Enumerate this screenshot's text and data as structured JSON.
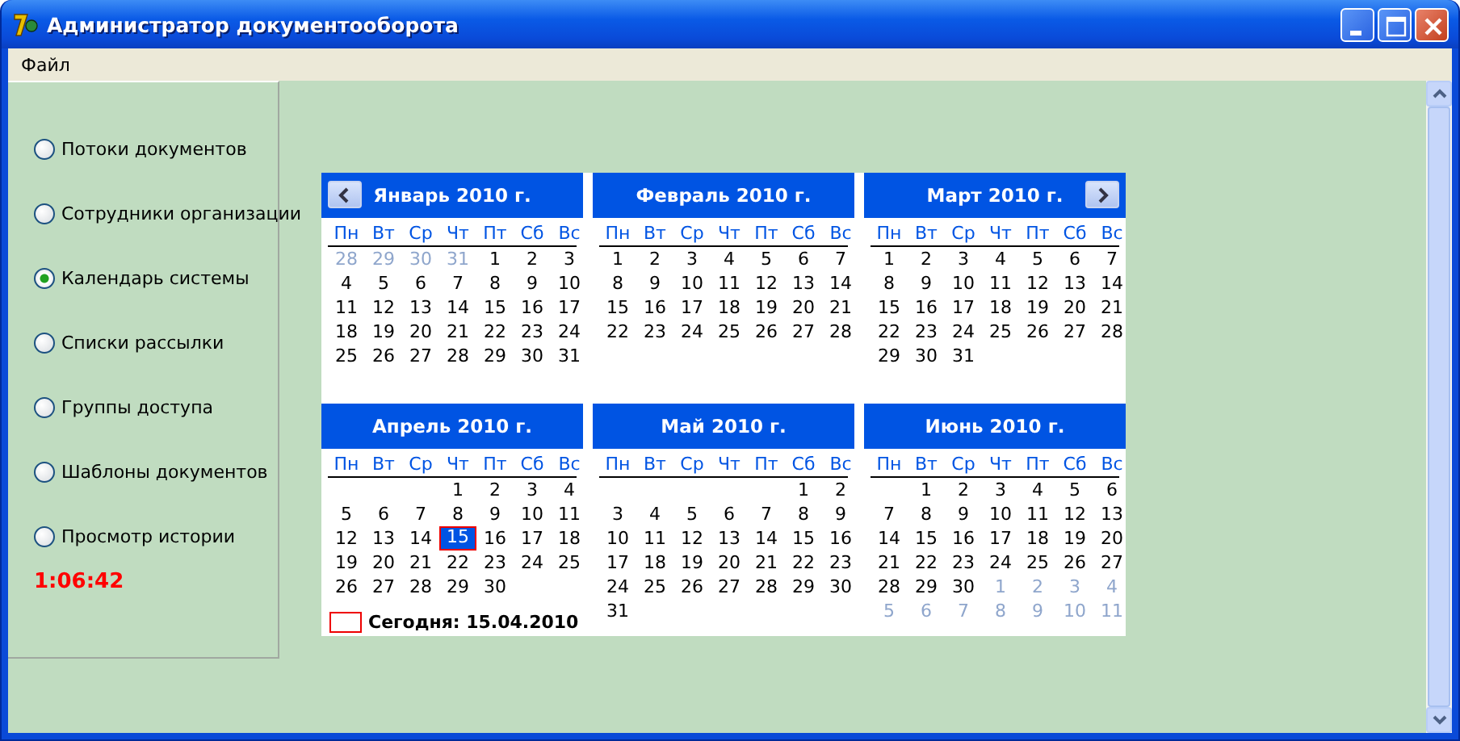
{
  "window": {
    "title": "Администратор документооборота"
  },
  "menu": [
    "Файл"
  ],
  "sidebar": {
    "options": [
      {
        "label": "Потоки документов",
        "selected": false
      },
      {
        "label": "Сотрудники организации",
        "selected": false
      },
      {
        "label": "Календарь системы",
        "selected": true
      },
      {
        "label": "Списки рассылки",
        "selected": false
      },
      {
        "label": "Группы доступа",
        "selected": false
      },
      {
        "label": "Шаблоны документов",
        "selected": false
      },
      {
        "label": "Просмотр истории",
        "selected": false
      }
    ],
    "clock": "1:06:42"
  },
  "calendar": {
    "months": [
      {
        "title": "Январь 2010 г.",
        "prev_button": true,
        "weekdays": [
          "Пн",
          "Вт",
          "Ср",
          "Чт",
          "Пт",
          "Сб",
          "Вс"
        ],
        "weeks": [
          [
            {
              "day": "28",
              "kind": "other"
            },
            {
              "day": "29",
              "kind": "other"
            },
            {
              "day": "30",
              "kind": "other"
            },
            {
              "day": "31",
              "kind": "other"
            },
            {
              "day": "1",
              "kind": "day"
            },
            {
              "day": "2",
              "kind": "day"
            },
            {
              "day": "3",
              "kind": "day"
            }
          ],
          [
            {
              "day": "4",
              "kind": "day"
            },
            {
              "day": "5",
              "kind": "day"
            },
            {
              "day": "6",
              "kind": "day"
            },
            {
              "day": "7",
              "kind": "day"
            },
            {
              "day": "8",
              "kind": "day"
            },
            {
              "day": "9",
              "kind": "day"
            },
            {
              "day": "10",
              "kind": "day"
            }
          ],
          [
            {
              "day": "11",
              "kind": "day"
            },
            {
              "day": "12",
              "kind": "day"
            },
            {
              "day": "13",
              "kind": "day"
            },
            {
              "day": "14",
              "kind": "day"
            },
            {
              "day": "15",
              "kind": "day"
            },
            {
              "day": "16",
              "kind": "day"
            },
            {
              "day": "17",
              "kind": "day"
            }
          ],
          [
            {
              "day": "18",
              "kind": "day"
            },
            {
              "day": "19",
              "kind": "day"
            },
            {
              "day": "20",
              "kind": "day"
            },
            {
              "day": "21",
              "kind": "day"
            },
            {
              "day": "22",
              "kind": "day"
            },
            {
              "day": "23",
              "kind": "day"
            },
            {
              "day": "24",
              "kind": "day"
            }
          ],
          [
            {
              "day": "25",
              "kind": "day"
            },
            {
              "day": "26",
              "kind": "day"
            },
            {
              "day": "27",
              "kind": "day"
            },
            {
              "day": "28",
              "kind": "day"
            },
            {
              "day": "29",
              "kind": "day"
            },
            {
              "day": "30",
              "kind": "day"
            },
            {
              "day": "31",
              "kind": "day"
            }
          ]
        ]
      },
      {
        "title": "Февраль 2010 г.",
        "weekdays": [
          "Пн",
          "Вт",
          "Ср",
          "Чт",
          "Пт",
          "Сб",
          "Вс"
        ],
        "weeks": [
          [
            {
              "day": "1",
              "kind": "day"
            },
            {
              "day": "2",
              "kind": "day"
            },
            {
              "day": "3",
              "kind": "day"
            },
            {
              "day": "4",
              "kind": "day"
            },
            {
              "day": "5",
              "kind": "day"
            },
            {
              "day": "6",
              "kind": "day"
            },
            {
              "day": "7",
              "kind": "day"
            }
          ],
          [
            {
              "day": "8",
              "kind": "day"
            },
            {
              "day": "9",
              "kind": "day"
            },
            {
              "day": "10",
              "kind": "day"
            },
            {
              "day": "11",
              "kind": "day"
            },
            {
              "day": "12",
              "kind": "day"
            },
            {
              "day": "13",
              "kind": "day"
            },
            {
              "day": "14",
              "kind": "day"
            }
          ],
          [
            {
              "day": "15",
              "kind": "day"
            },
            {
              "day": "16",
              "kind": "day"
            },
            {
              "day": "17",
              "kind": "day"
            },
            {
              "day": "18",
              "kind": "day"
            },
            {
              "day": "19",
              "kind": "day"
            },
            {
              "day": "20",
              "kind": "day"
            },
            {
              "day": "21",
              "kind": "day"
            }
          ],
          [
            {
              "day": "22",
              "kind": "day"
            },
            {
              "day": "23",
              "kind": "day"
            },
            {
              "day": "24",
              "kind": "day"
            },
            {
              "day": "25",
              "kind": "day"
            },
            {
              "day": "26",
              "kind": "day"
            },
            {
              "day": "27",
              "kind": "day"
            },
            {
              "day": "28",
              "kind": "day"
            }
          ]
        ]
      },
      {
        "title": "Март 2010 г.",
        "next_button": true,
        "weekdays": [
          "Пн",
          "Вт",
          "Ср",
          "Чт",
          "Пт",
          "Сб",
          "Вс"
        ],
        "weeks": [
          [
            {
              "day": "1",
              "kind": "day"
            },
            {
              "day": "2",
              "kind": "day"
            },
            {
              "day": "3",
              "kind": "day"
            },
            {
              "day": "4",
              "kind": "day"
            },
            {
              "day": "5",
              "kind": "day"
            },
            {
              "day": "6",
              "kind": "day"
            },
            {
              "day": "7",
              "kind": "day"
            }
          ],
          [
            {
              "day": "8",
              "kind": "day"
            },
            {
              "day": "9",
              "kind": "day"
            },
            {
              "day": "10",
              "kind": "day"
            },
            {
              "day": "11",
              "kind": "day"
            },
            {
              "day": "12",
              "kind": "day"
            },
            {
              "day": "13",
              "kind": "day"
            },
            {
              "day": "14",
              "kind": "day"
            }
          ],
          [
            {
              "day": "15",
              "kind": "day"
            },
            {
              "day": "16",
              "kind": "day"
            },
            {
              "day": "17",
              "kind": "day"
            },
            {
              "day": "18",
              "kind": "day"
            },
            {
              "day": "19",
              "kind": "day"
            },
            {
              "day": "20",
              "kind": "day"
            },
            {
              "day": "21",
              "kind": "day"
            }
          ],
          [
            {
              "day": "22",
              "kind": "day"
            },
            {
              "day": "23",
              "kind": "day"
            },
            {
              "day": "24",
              "kind": "day"
            },
            {
              "day": "25",
              "kind": "day"
            },
            {
              "day": "26",
              "kind": "day"
            },
            {
              "day": "27",
              "kind": "day"
            },
            {
              "day": "28",
              "kind": "day"
            }
          ],
          [
            {
              "day": "29",
              "kind": "day"
            },
            {
              "day": "30",
              "kind": "day"
            },
            {
              "day": "31",
              "kind": "day"
            }
          ]
        ]
      },
      {
        "title": "Апрель 2010 г.",
        "weekdays": [
          "Пн",
          "Вт",
          "Ср",
          "Чт",
          "Пт",
          "Сб",
          "Вс"
        ],
        "weeks": [
          [
            {
              "kind": "blank"
            },
            {
              "kind": "blank"
            },
            {
              "kind": "blank"
            },
            {
              "day": "1",
              "kind": "day"
            },
            {
              "day": "2",
              "kind": "day"
            },
            {
              "day": "3",
              "kind": "day"
            },
            {
              "day": "4",
              "kind": "day"
            }
          ],
          [
            {
              "day": "5",
              "kind": "day"
            },
            {
              "day": "6",
              "kind": "day"
            },
            {
              "day": "7",
              "kind": "day"
            },
            {
              "day": "8",
              "kind": "day"
            },
            {
              "day": "9",
              "kind": "day"
            },
            {
              "day": "10",
              "kind": "day"
            },
            {
              "day": "11",
              "kind": "day"
            }
          ],
          [
            {
              "day": "12",
              "kind": "day"
            },
            {
              "day": "13",
              "kind": "day"
            },
            {
              "day": "14",
              "kind": "day"
            },
            {
              "day": "15",
              "kind": "today"
            },
            {
              "day": "16",
              "kind": "day"
            },
            {
              "day": "17",
              "kind": "day"
            },
            {
              "day": "18",
              "kind": "day"
            }
          ],
          [
            {
              "day": "19",
              "kind": "day"
            },
            {
              "day": "20",
              "kind": "day"
            },
            {
              "day": "21",
              "kind": "day"
            },
            {
              "day": "22",
              "kind": "day"
            },
            {
              "day": "23",
              "kind": "day"
            },
            {
              "day": "24",
              "kind": "day"
            },
            {
              "day": "25",
              "kind": "day"
            }
          ],
          [
            {
              "day": "26",
              "kind": "day"
            },
            {
              "day": "27",
              "kind": "day"
            },
            {
              "day": "28",
              "kind": "day"
            },
            {
              "day": "29",
              "kind": "day"
            },
            {
              "day": "30",
              "kind": "day"
            }
          ]
        ]
      },
      {
        "title": "Май 2010 г.",
        "weekdays": [
          "Пн",
          "Вт",
          "Ср",
          "Чт",
          "Пт",
          "Сб",
          "Вс"
        ],
        "weeks": [
          [
            {
              "kind": "blank"
            },
            {
              "kind": "blank"
            },
            {
              "kind": "blank"
            },
            {
              "kind": "blank"
            },
            {
              "kind": "blank"
            },
            {
              "day": "1",
              "kind": "day"
            },
            {
              "day": "2",
              "kind": "day"
            }
          ],
          [
            {
              "day": "3",
              "kind": "day"
            },
            {
              "day": "4",
              "kind": "day"
            },
            {
              "day": "5",
              "kind": "day"
            },
            {
              "day": "6",
              "kind": "day"
            },
            {
              "day": "7",
              "kind": "day"
            },
            {
              "day": "8",
              "kind": "day"
            },
            {
              "day": "9",
              "kind": "day"
            }
          ],
          [
            {
              "day": "10",
              "kind": "day"
            },
            {
              "day": "11",
              "kind": "day"
            },
            {
              "day": "12",
              "kind": "day"
            },
            {
              "day": "13",
              "kind": "day"
            },
            {
              "day": "14",
              "kind": "day"
            },
            {
              "day": "15",
              "kind": "day"
            },
            {
              "day": "16",
              "kind": "day"
            }
          ],
          [
            {
              "day": "17",
              "kind": "day"
            },
            {
              "day": "18",
              "kind": "day"
            },
            {
              "day": "19",
              "kind": "day"
            },
            {
              "day": "20",
              "kind": "day"
            },
            {
              "day": "21",
              "kind": "day"
            },
            {
              "day": "22",
              "kind": "day"
            },
            {
              "day": "23",
              "kind": "day"
            }
          ],
          [
            {
              "day": "24",
              "kind": "day"
            },
            {
              "day": "25",
              "kind": "day"
            },
            {
              "day": "26",
              "kind": "day"
            },
            {
              "day": "27",
              "kind": "day"
            },
            {
              "day": "28",
              "kind": "day"
            },
            {
              "day": "29",
              "kind": "day"
            },
            {
              "day": "30",
              "kind": "day"
            }
          ],
          [
            {
              "day": "31",
              "kind": "day"
            }
          ]
        ]
      },
      {
        "title": "Июнь 2010 г.",
        "weekdays": [
          "Пн",
          "Вт",
          "Ср",
          "Чт",
          "Пт",
          "Сб",
          "Вс"
        ],
        "weeks": [
          [
            {
              "kind": "blank"
            },
            {
              "day": "1",
              "kind": "day"
            },
            {
              "day": "2",
              "kind": "day"
            },
            {
              "day": "3",
              "kind": "day"
            },
            {
              "day": "4",
              "kind": "day"
            },
            {
              "day": "5",
              "kind": "day"
            },
            {
              "day": "6",
              "kind": "day"
            }
          ],
          [
            {
              "day": "7",
              "kind": "day"
            },
            {
              "day": "8",
              "kind": "day"
            },
            {
              "day": "9",
              "kind": "day"
            },
            {
              "day": "10",
              "kind": "day"
            },
            {
              "day": "11",
              "kind": "day"
            },
            {
              "day": "12",
              "kind": "day"
            },
            {
              "day": "13",
              "kind": "day"
            }
          ],
          [
            {
              "day": "14",
              "kind": "day"
            },
            {
              "day": "15",
              "kind": "day"
            },
            {
              "day": "16",
              "kind": "day"
            },
            {
              "day": "17",
              "kind": "day"
            },
            {
              "day": "18",
              "kind": "day"
            },
            {
              "day": "19",
              "kind": "day"
            },
            {
              "day": "20",
              "kind": "day"
            }
          ],
          [
            {
              "day": "21",
              "kind": "day"
            },
            {
              "day": "22",
              "kind": "day"
            },
            {
              "day": "23",
              "kind": "day"
            },
            {
              "day": "24",
              "kind": "day"
            },
            {
              "day": "25",
              "kind": "day"
            },
            {
              "day": "26",
              "kind": "day"
            },
            {
              "day": "27",
              "kind": "day"
            }
          ],
          [
            {
              "day": "28",
              "kind": "day"
            },
            {
              "day": "29",
              "kind": "day"
            },
            {
              "day": "30",
              "kind": "day"
            },
            {
              "day": "1",
              "kind": "other"
            },
            {
              "day": "2",
              "kind": "other"
            },
            {
              "day": "3",
              "kind": "other"
            },
            {
              "day": "4",
              "kind": "other"
            }
          ],
          [
            {
              "day": "5",
              "kind": "other"
            },
            {
              "day": "6",
              "kind": "other"
            },
            {
              "day": "7",
              "kind": "other"
            },
            {
              "day": "8",
              "kind": "other"
            },
            {
              "day": "9",
              "kind": "other"
            },
            {
              "day": "10",
              "kind": "other"
            },
            {
              "day": "11",
              "kind": "other"
            }
          ]
        ]
      }
    ],
    "today_label": "Сегодня: 15.04.2010"
  }
}
